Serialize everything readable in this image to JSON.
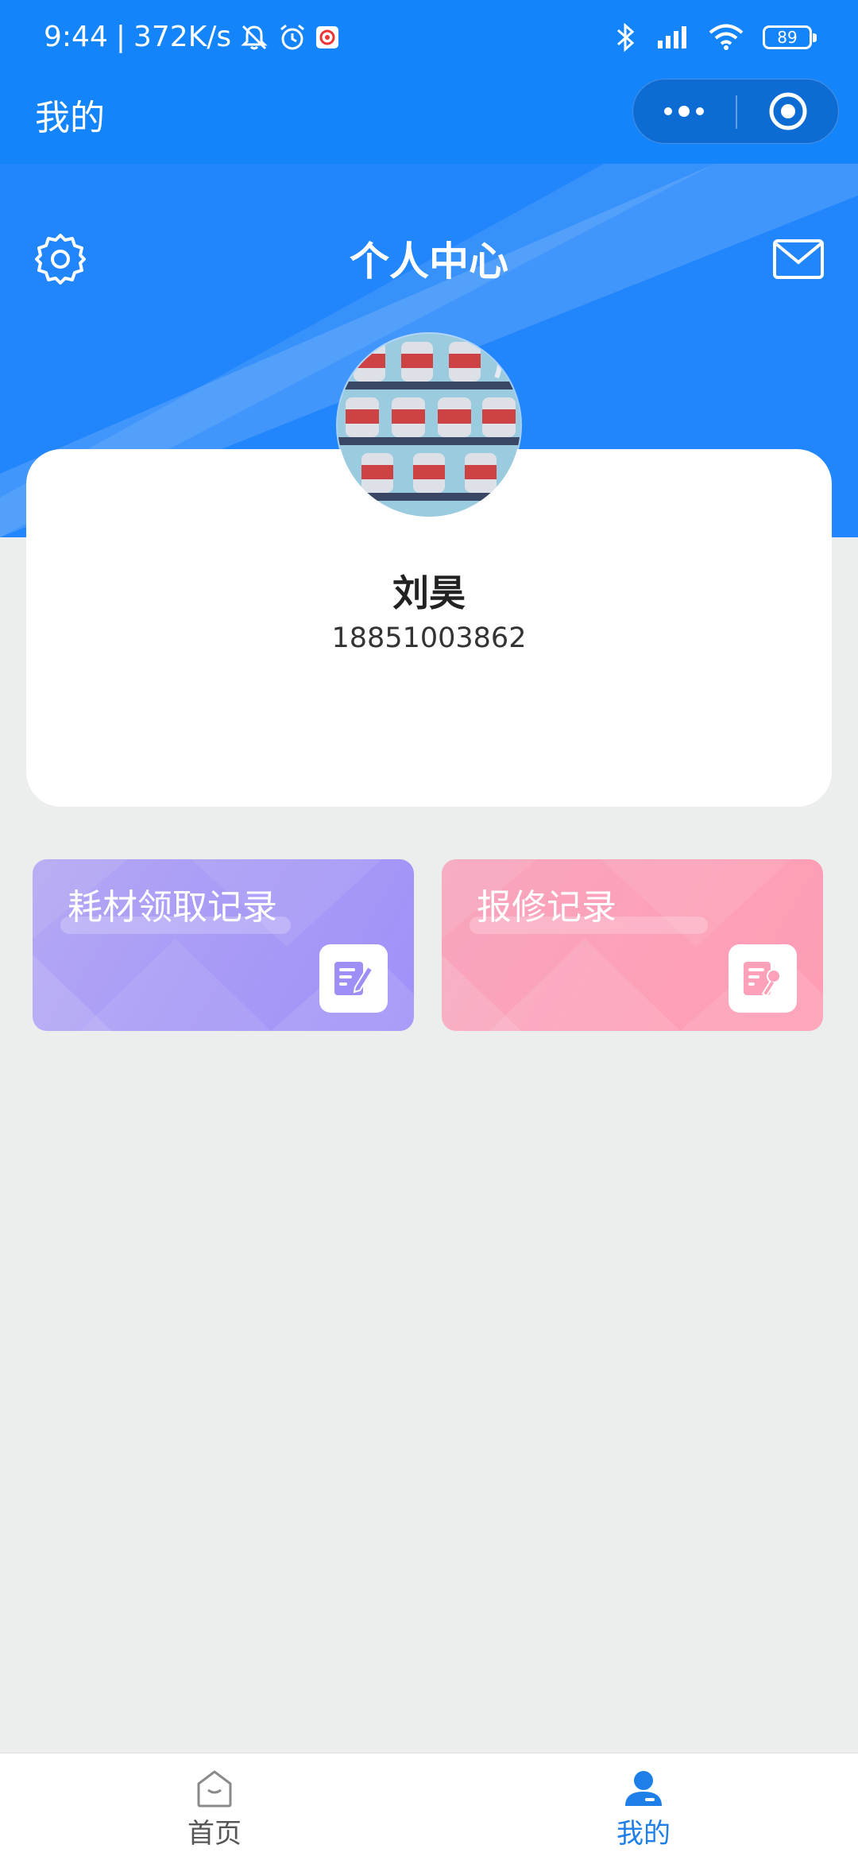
{
  "status_bar": {
    "time": "9:44",
    "network_speed": "372K/s",
    "battery_level": "89",
    "icons": [
      "mute-bell-icon",
      "alarm-icon",
      "app-notification-icon",
      "bluetooth-icon",
      "signal-icon",
      "wifi-icon",
      "battery-icon"
    ]
  },
  "nav": {
    "title": "我的",
    "capsule_icons": [
      "more-dots-icon",
      "close-target-icon"
    ]
  },
  "header": {
    "title": "个人中心",
    "left_icon": "gear-icon",
    "right_icon": "mail-icon"
  },
  "profile": {
    "name": "刘昊",
    "phone": "18851003862",
    "avatar_icon": "avatar"
  },
  "records": {
    "consumables_label": "耗材领取记录",
    "consumables_icon": "edit-note-icon",
    "repair_label": "报修记录",
    "repair_icon": "repair-doc-icon"
  },
  "tabs": {
    "home_label": "首页",
    "home_icon": "home-icon",
    "mine_label": "我的",
    "mine_icon": "user-icon",
    "active": "mine"
  },
  "colors": {
    "primary": "#1484fa",
    "header_bg": "#2185fb",
    "page_bg": "#eceeee",
    "consumables_tile": "#a99cf6",
    "repair_tile": "#fca1b9",
    "active_tab": "#1e7fe9"
  }
}
